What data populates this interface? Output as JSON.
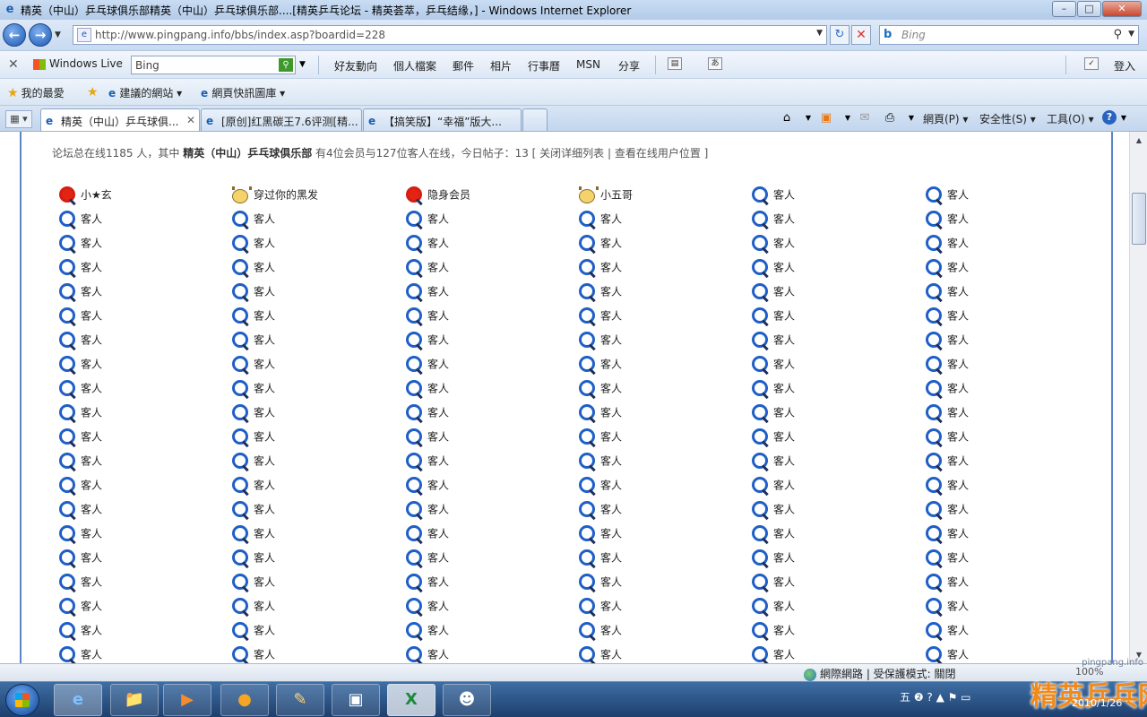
{
  "window": {
    "title": "精英（中山）乒乓球俱乐部精英（中山）乒乓球俱乐部....[精英乒乓论坛 - 精英荟萃，乒乓结缘，] - Windows Internet Explorer",
    "minimize": "–",
    "maximize": "□",
    "close": "✕"
  },
  "address": {
    "url": "http://www.pingpang.info/bbs/index.asp?boardid=228",
    "search_placeholder": "Bing"
  },
  "wl_toolbar": {
    "brand": "Windows Live",
    "search_value": "Bing",
    "items": [
      "好友動向",
      "個人檔案",
      "郵件",
      "相片",
      "行事曆",
      "MSN",
      "分享"
    ],
    "login": "登入"
  },
  "favorites": {
    "label": "我的最愛",
    "suggested": "建議的網站 ▾",
    "webslice": "網頁快訊圖庫 ▾"
  },
  "tabs": [
    {
      "label": "精英（中山）乒乓球俱...",
      "active": true
    },
    {
      "label": "[原创]红黑碳王7.6评测[精...",
      "active": false
    },
    {
      "label": "【搞笑版】“幸福”版大...",
      "active": false
    }
  ],
  "commands": {
    "page": "網頁(P) ▾",
    "safety": "安全性(S) ▾",
    "tools": "工具(O) ▾"
  },
  "forum": {
    "summary_prefix": "论坛总在线1185 人，其中",
    "club_name": "精英（中山）乒乓球俱乐部",
    "summary_suffix": "有4位会员与127位客人在线，今日帖子：13 [ 关闭详细列表 | 查看在线用户位置 ]"
  },
  "online_users": {
    "first_row": [
      {
        "name": "小★玄",
        "icon": "red-magnifier-icon"
      },
      {
        "name": "穿过你的黑发",
        "icon": "bear-icon"
      },
      {
        "name": "隐身会员",
        "icon": "red-magnifier-icon"
      },
      {
        "name": "小五哥",
        "icon": "bear-icon"
      },
      {
        "name": "客人",
        "icon": "magnifier-icon"
      },
      {
        "name": "客人",
        "icon": "magnifier-icon"
      }
    ],
    "guest_label": "客人",
    "guest_rows_visible": 19
  },
  "statusbar": {
    "zone": "網際網路 | 受保護模式: 關閉",
    "zoom": "100%"
  },
  "watermark": {
    "site": "pingpang.info",
    "brand": "精英乒乓网"
  },
  "clock": "2010/1/26"
}
